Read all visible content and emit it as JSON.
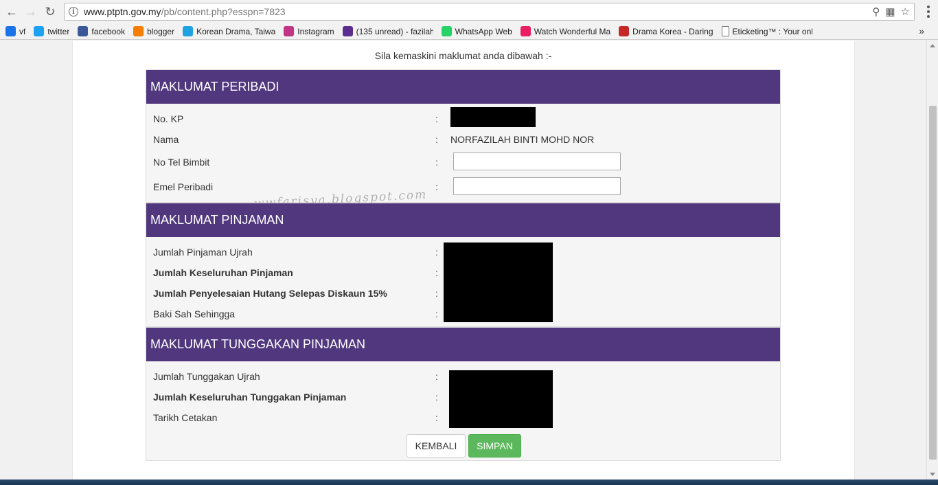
{
  "browser": {
    "url_host": "www.ptptn.gov.my",
    "url_path": "/pb/content.php?esspn=7823",
    "bookmarks": [
      {
        "label": "vf",
        "icon": "vf-icon",
        "color": "#1a73e8"
      },
      {
        "label": "twitter",
        "icon": "twitter-icon",
        "color": "#1da1f2"
      },
      {
        "label": "facebook",
        "icon": "facebook-icon",
        "color": "#3b5998"
      },
      {
        "label": "blogger",
        "icon": "blogger-icon",
        "color": "#f57d00"
      },
      {
        "label": "Korean Drama, Taiwa",
        "icon": "viki-icon",
        "color": "#1fa3e0"
      },
      {
        "label": "Instagram",
        "icon": "instagram-icon",
        "color": "#c13584"
      },
      {
        "label": "(135 unread) - fazilah_",
        "icon": "mail-icon",
        "color": "#5c2d91"
      },
      {
        "label": "WhatsApp Web",
        "icon": "whatsapp-icon",
        "color": "#25d366"
      },
      {
        "label": "Watch Wonderful Ma",
        "icon": "watch-icon",
        "color": "#e91e63"
      },
      {
        "label": "Drama Korea - Daring",
        "icon": "drama-icon",
        "color": "#c62828"
      },
      {
        "label": "Eticketing™ : Your onl",
        "icon": "page-icon",
        "color": "#ffffff"
      }
    ]
  },
  "intro_text": "Sila kemaskini maklumat anda dibawah :-",
  "watermark": "wwfarisya.blogspot.com",
  "personal": {
    "title": "MAKLUMAT PERIBADI",
    "no_kp_label": "No. KP",
    "nama_label": "Nama",
    "nama_value": "NORFAZILAH BINTI MOHD NOR",
    "tel_label": "No Tel Bimbit",
    "email_label": "Emel Peribadi"
  },
  "loan": {
    "title": "MAKLUMAT PINJAMAN",
    "rows": [
      {
        "label": "Jumlah Pinjaman Ujrah",
        "bold": false
      },
      {
        "label": "Jumlah Keseluruhan Pinjaman",
        "bold": true
      },
      {
        "label": "Jumlah Penyelesaian Hutang Selepas Diskaun 15%",
        "bold": true
      },
      {
        "label": "Baki Sah Sehingga",
        "bold": false
      }
    ]
  },
  "arrears": {
    "title": "MAKLUMAT TUNGGAKAN PINJAMAN",
    "rows": [
      {
        "label": "Jumlah Tunggakan Ujrah",
        "bold": false
      },
      {
        "label": "Jumlah Keseluruhan Tunggakan Pinjaman",
        "bold": true
      },
      {
        "label": "Tarikh Cetakan",
        "bold": false
      }
    ]
  },
  "colon": ":",
  "buttons": {
    "back": "KEMBALI",
    "save": "SIMPAN"
  },
  "colors": {
    "header_purple": "#51387e",
    "save_green": "#5cb85c"
  }
}
